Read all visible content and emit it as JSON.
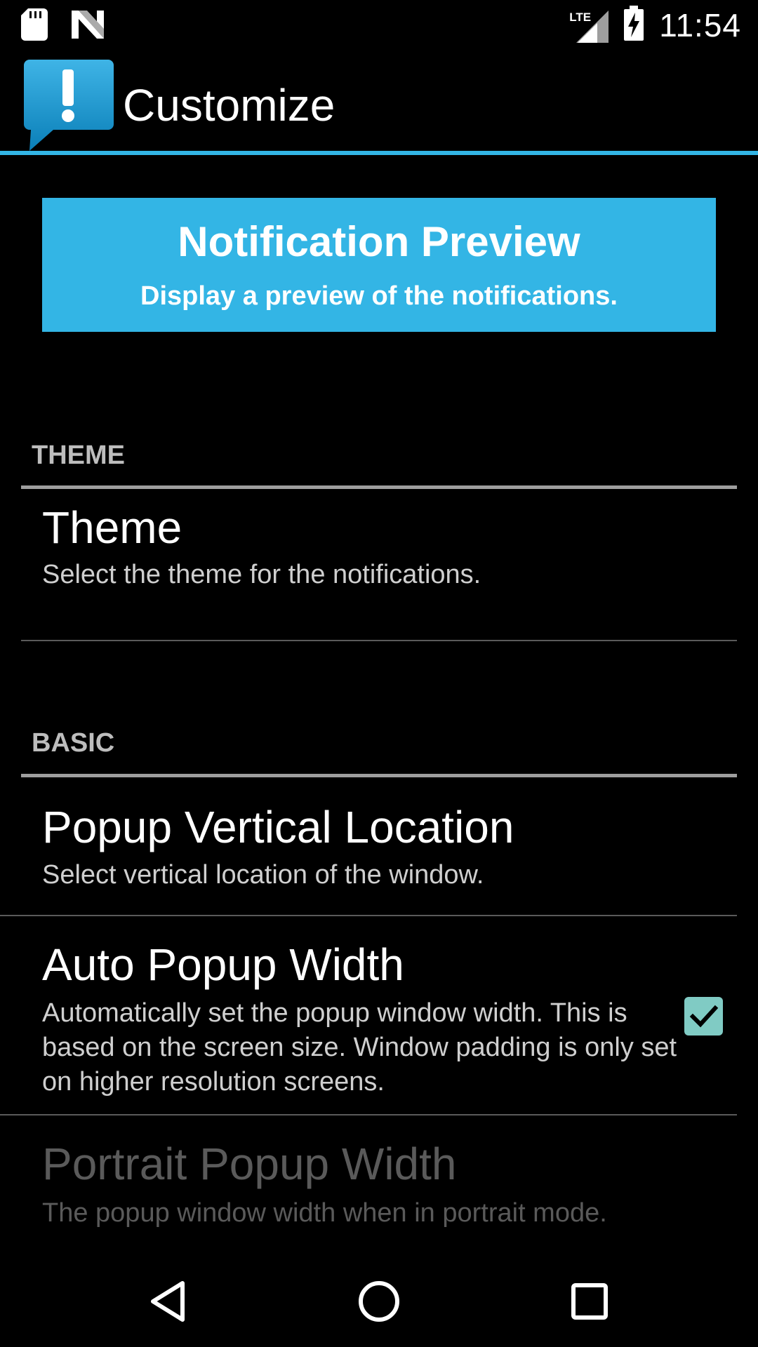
{
  "status_bar": {
    "time": "11:54",
    "network": "LTE",
    "icons": [
      "sd-card-icon",
      "n-notification-icon",
      "lte-signal-icon",
      "battery-charging-icon"
    ]
  },
  "action_bar": {
    "title": "Customize",
    "app_icon": "alert-speech-bubble-icon"
  },
  "colors": {
    "accent": "#33b5e5",
    "checkbox": "#80cbc4",
    "category_text": "#bdbdbd",
    "disabled_text": "#5a5a5a"
  },
  "preview_button": {
    "title": "Notification Preview",
    "subtitle": "Display a preview of the notifications."
  },
  "sections": {
    "theme": {
      "header": "THEME",
      "items": [
        {
          "title": "Theme",
          "summary": "Select the theme for the notifications."
        }
      ]
    },
    "basic": {
      "header": "BASIC",
      "items": [
        {
          "title": "Popup Vertical Location",
          "summary": "Select vertical location of the window."
        },
        {
          "title": "Auto Popup Width",
          "summary": "Automatically set the popup window width. This is based on the screen size. Window padding is only set on higher resolution screens.",
          "checked": true
        },
        {
          "title": "Portrait Popup Width",
          "summary": "The popup window width when in portrait mode.",
          "enabled": false
        }
      ]
    }
  },
  "nav_bar": {
    "buttons": [
      "back-icon",
      "home-icon",
      "recents-icon"
    ]
  }
}
